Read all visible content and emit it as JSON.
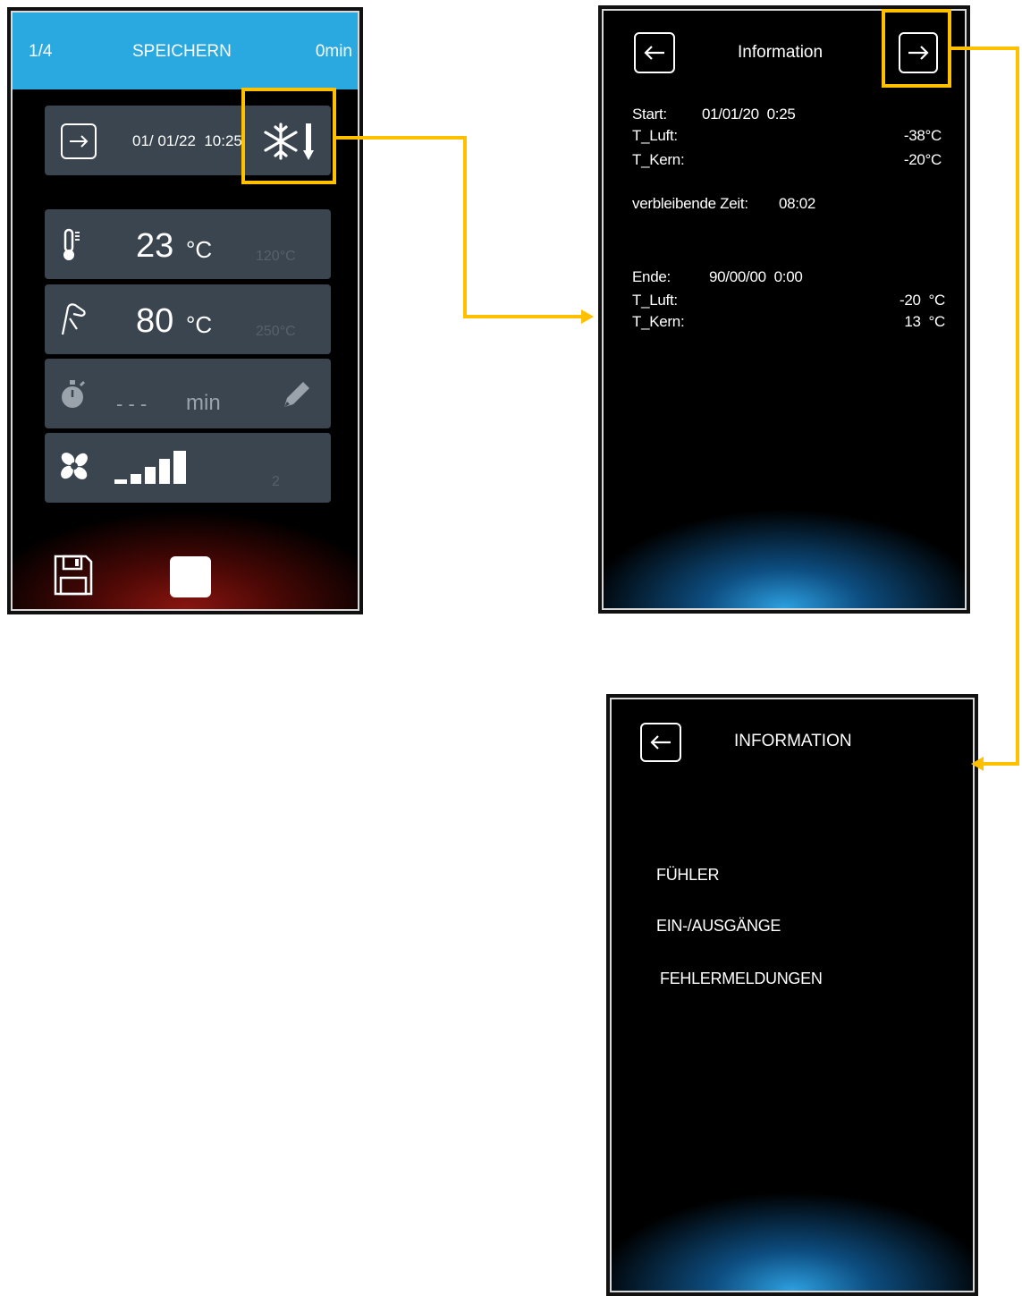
{
  "screen_main": {
    "program_index": "1/4",
    "title": "SPEICHERN",
    "time": "0min",
    "date_time": "01/ 01/22  10:25",
    "air_temp": {
      "value": "23",
      "unit": "°C",
      "max": "120°C"
    },
    "core_temp": {
      "value": "80",
      "unit": "°C",
      "max": "250°C"
    },
    "timer": {
      "value": "- - -",
      "unit": "min"
    },
    "fan": {
      "level": "2",
      "bars_filled": 5
    }
  },
  "screen_information": {
    "title": "Information",
    "start_label": "Start:",
    "start_value": "01/01/20  0:25",
    "t_luft_label": "T_Luft:",
    "t_luft_start": "-38°C",
    "t_kern_label": "T_Kern:",
    "t_kern_start": "-20°C",
    "remaining_label": "verbleibende Zeit:",
    "remaining_value": "08:02",
    "ende_label": "Ende:",
    "ende_value": "90/00/00  0:00",
    "t_luft_ende_label": "T_Luft:",
    "t_luft_ende": "-20  °C",
    "t_kern_ende_label": "T_Kern:",
    "t_kern_ende": "13  °C"
  },
  "screen_information_menu": {
    "title": "INFORMATION",
    "items": [
      "FÜHLER",
      "EIN-/AUSGÄNGE",
      "FEHLERMELDUNGEN"
    ]
  },
  "colors": {
    "header_blue": "#29a9e0",
    "card_gray": "#3a4550",
    "highlight": "#ffc000",
    "glow_red": "#8a1510",
    "glow_blue": "#2da0e0"
  }
}
